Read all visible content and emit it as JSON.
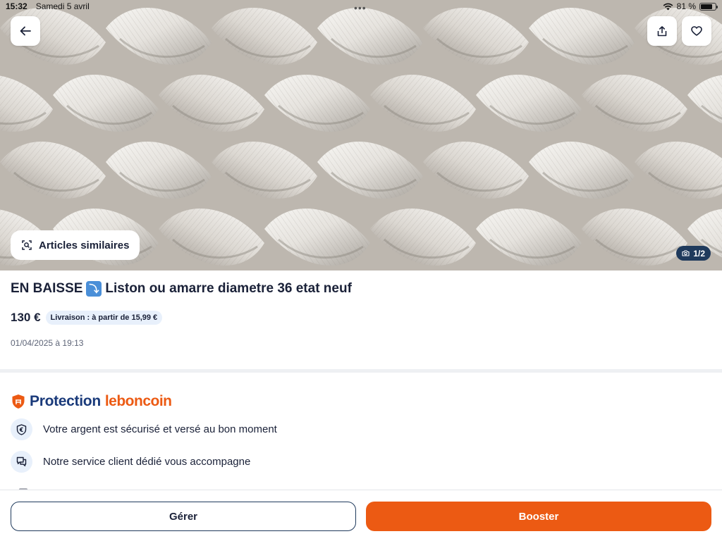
{
  "status_bar": {
    "time": "15:32",
    "date": "Samedi 5 avril",
    "battery": "81 %",
    "battery_level": 0.81
  },
  "hero": {
    "photo_description_icon": "rope-photo",
    "similar_label": "Articles similaires",
    "photo_counter": "1/2"
  },
  "listing": {
    "title_prefix": "EN BAISSE",
    "title_emoji": "⤵",
    "title_rest": "Liston ou amarre diametre 36 etat neuf",
    "price": "130 €",
    "delivery": "Livraison : à partir de 15,99 €",
    "date": "01/04/2025 à 19:13"
  },
  "protection": {
    "title_part1": "Protection",
    "title_part2": "leboncoin",
    "features": [
      {
        "icon": "euro-shield-icon",
        "text": "Votre argent est sécurisé et versé au bon moment"
      },
      {
        "icon": "chat-icon",
        "text": "Notre service client dédié vous accompagne"
      }
    ]
  },
  "actions": {
    "manage": "Gérer",
    "boost": "Booster"
  },
  "colors": {
    "brand_orange": "#ec5a13",
    "navy": "#1a2138",
    "badge_blue": "#e8f0fb"
  }
}
